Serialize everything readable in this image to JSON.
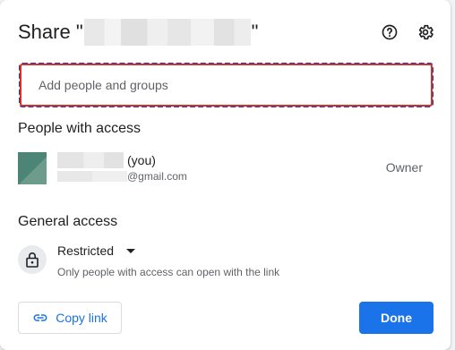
{
  "dialog": {
    "title_prefix": "Share \"",
    "title_suffix": "\"",
    "help_icon": "help-circle-icon",
    "settings_icon": "gear-icon"
  },
  "add_people": {
    "placeholder": "Add people and groups"
  },
  "people_section": {
    "title": "People with access",
    "people": [
      {
        "name_suffix": "(you)",
        "email_suffix": "@gmail.com",
        "role": "Owner"
      }
    ]
  },
  "general_access": {
    "title": "General access",
    "lock_icon": "lock-icon",
    "level": "Restricted",
    "description": "Only people with access can open with the link"
  },
  "footer": {
    "copy_link_label": "Copy link",
    "copy_link_icon": "link-icon",
    "done_label": "Done"
  },
  "colors": {
    "accent": "#1a73e8",
    "focus_outline": "#d93025",
    "focus_dash": "#1a3fae"
  }
}
